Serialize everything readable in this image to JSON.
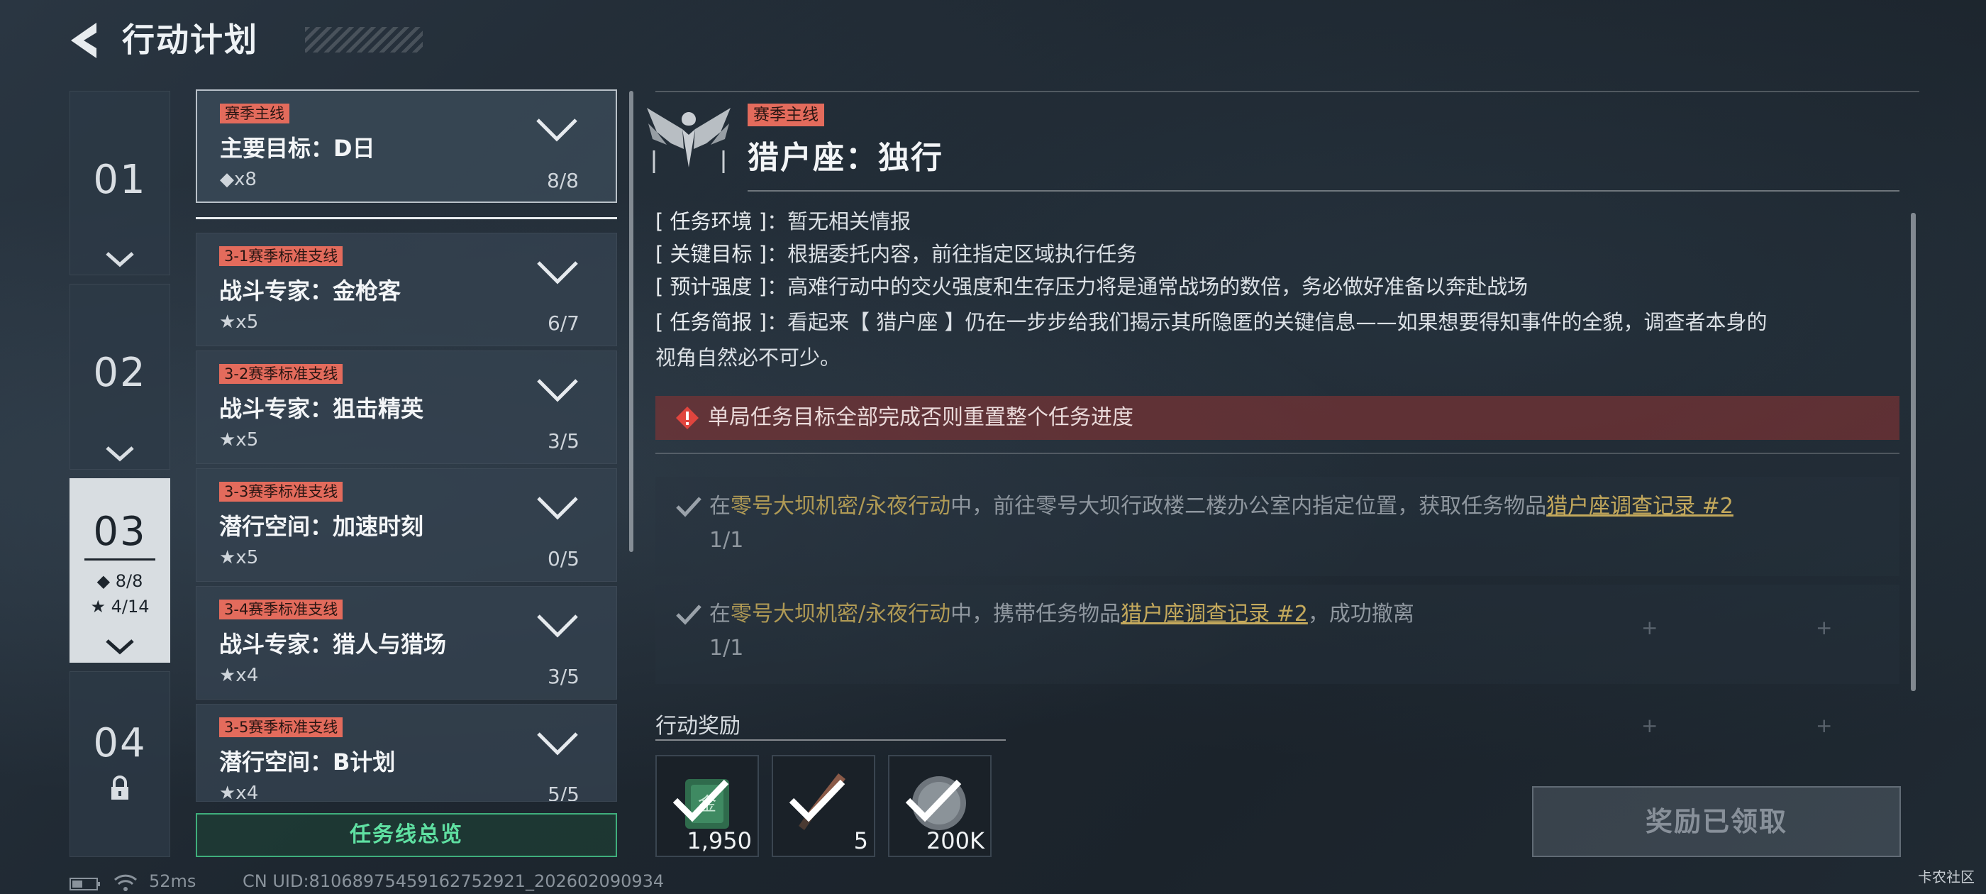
{
  "header": {
    "title": "行动计划"
  },
  "chapters": [
    {
      "num": "01"
    },
    {
      "num": "02"
    },
    {
      "num": "03",
      "diamond_stat": "◆ 8/8",
      "star_stat": "★ 4/14"
    },
    {
      "num": "04"
    }
  ],
  "missions": [
    {
      "tag": "赛季主线",
      "title": "主要目标：D日",
      "reward": "◆x8",
      "progress": "8/8"
    },
    {
      "tag": "3-1赛季标准支线",
      "title": "战斗专家：金枪客",
      "reward": "★x5",
      "progress": "6/7"
    },
    {
      "tag": "3-2赛季标准支线",
      "title": "战斗专家：狙击精英",
      "reward": "★x5",
      "progress": "3/5"
    },
    {
      "tag": "3-3赛季标准支线",
      "title": "潜行空间：加速时刻",
      "reward": "★x5",
      "progress": "0/5"
    },
    {
      "tag": "3-4赛季标准支线",
      "title": "战斗专家：猎人与猎场",
      "reward": "★x4",
      "progress": "3/5"
    },
    {
      "tag": "3-5赛季标准支线",
      "title": "潜行空间：B计划",
      "reward": "★x4",
      "progress": "5/5"
    }
  ],
  "overview_button": "任务线总览",
  "detail": {
    "tag": "赛季主线",
    "title": "猎户座：独行",
    "info": [
      {
        "label": "[ 任务环境 ]",
        "text": "：暂无相关情报"
      },
      {
        "label": "[ 关键目标 ]",
        "text": "：根据委托内容，前往指定区域执行任务"
      },
      {
        "label": "[ 预计强度 ]",
        "text": "：高难行动中的交火强度和生存压力将是通常战场的数倍，务必做好准备以奔赴战场"
      },
      {
        "label": "[ 任务简报 ]",
        "text": "：看起来【 猎户座 】仍在一步步给我们揭示其所隐匿的关键信息——如果想要得知事件的全貌，调查者本身的",
        "text2": "视角自然必不可少。"
      }
    ],
    "warning": "单局任务目标全部完成否则重置整个任务进度",
    "objectives": [
      {
        "pre": "在",
        "location": "零号大坝机密/永夜行动",
        "mid": "中，前往零号大坝行政楼二楼办公室内指定位置，获取任务物品",
        "item": "猎户座调查记录 #2",
        "post": "",
        "progress": "1/1"
      },
      {
        "pre": "在",
        "location": "零号大坝机密/永夜行动",
        "mid": "中，携带任务物品",
        "item": "猎户座调查记录 #2",
        "post": "，成功撤离",
        "progress": "1/1"
      }
    ]
  },
  "rewards": {
    "label": "行动奖励",
    "items": [
      {
        "icon": "currency-icon",
        "qty": "1,950"
      },
      {
        "icon": "knife-icon",
        "qty": "5"
      },
      {
        "icon": "coin-icon",
        "qty": "200K"
      }
    ]
  },
  "claimed_button": "奖励已领取",
  "footer": {
    "ping": "52ms",
    "uid": "CN UID:81068975459162752921_202602090934",
    "watermark": "卡农社区"
  },
  "colors": {
    "tag": "#e36b5c",
    "accent_green": "#5fe0a2",
    "highlight_gold": "#c4a95c",
    "warning_bg": "#843434"
  }
}
